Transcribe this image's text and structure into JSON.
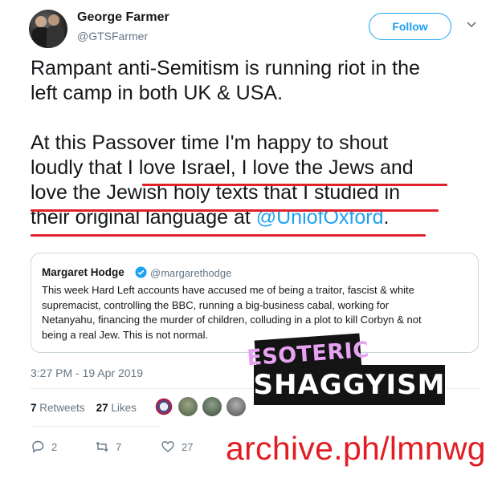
{
  "tweet": {
    "author_name": "George Farmer",
    "author_handle": "@GTSFarmer",
    "follow_label": "Follow",
    "line1": "Rampant anti-Semitism is running riot in the",
    "line2": "left camp in both UK & USA.",
    "line3": "At this Passover time I'm happy to shout",
    "line4a": "loudly that ",
    "line4b": "I love Israel, I love the Jews and",
    "line5": "love the Jewish holy texts that I studied in",
    "line6a": "their original language at ",
    "line6_mention": "@UniofOxford",
    "line6b": ".",
    "timestamp": "3:27 PM - 19 Apr 2019",
    "retweets_count": "7",
    "retweets_label": "Retweets",
    "likes_count": "27",
    "likes_label": "Likes",
    "replies": "2",
    "retweets_action": "7",
    "likes_action": "27"
  },
  "quoted": {
    "author_name": "Margaret Hodge",
    "author_handle": "@margarethodge",
    "text_line1": "This week Hard Left accounts have accused me of being a traitor, fascist & white",
    "text_line2": "supremacist, controlling the BBC, running a big-business cabal, working for",
    "text_line3": "Netanyahu, financing the murder of children, colluding in a plot to kill Corbyn & not",
    "text_line4": "being a real Jew. This is not normal."
  },
  "overlay": {
    "esoteric": "ESOTERIC",
    "shaggyism": "SHAGGYISM",
    "archive": "archive.ph/lmnwg"
  },
  "colors": {
    "accent": "#1da1f2",
    "underline": "#e0212c",
    "archive_text": "#e21c23",
    "esoteric_text": "#e7a3f1"
  }
}
